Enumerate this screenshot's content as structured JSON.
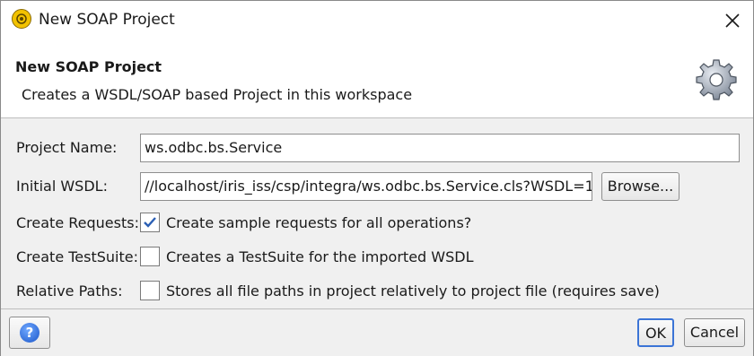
{
  "window": {
    "title": "New SOAP Project",
    "app_icon": "soapui-icon",
    "close_icon": "close-icon"
  },
  "header": {
    "title": "New SOAP Project",
    "description": "Creates a WSDL/SOAP based Project in this workspace",
    "icon": "gear-icon"
  },
  "form": {
    "project_name": {
      "label": "Project Name:",
      "value": "ws.odbc.bs.Service"
    },
    "initial_wsdl": {
      "label": "Initial WSDL:",
      "value": "//localhost/iris_iss/csp/integra/ws.odbc.bs.Service.cls?WSDL=1",
      "browse_label": "Browse..."
    },
    "create_requests": {
      "label": "Create Requests:",
      "checked": true,
      "text": "Create sample requests for all operations?"
    },
    "create_testsuite": {
      "label": "Create TestSuite:",
      "checked": false,
      "text": "Creates a TestSuite for the imported WSDL"
    },
    "relative_paths": {
      "label": "Relative Paths:",
      "checked": false,
      "text": "Stores all file paths in project relatively to project file (requires save)"
    }
  },
  "footer": {
    "help_symbol": "?",
    "help_icon": "help-icon",
    "ok_label": "OK",
    "cancel_label": "Cancel"
  }
}
